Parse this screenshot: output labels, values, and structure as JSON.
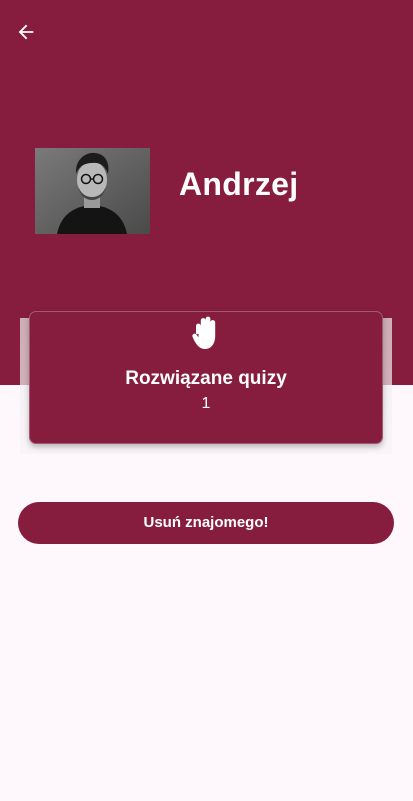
{
  "colors": {
    "primary": "#861d3f",
    "background": "#fef8fd",
    "text_on_primary": "#ffffff"
  },
  "header": {
    "back_icon": "arrow-left-icon"
  },
  "profile": {
    "name": "Andrzej",
    "avatar_icon": "avatar-photo"
  },
  "stats": {
    "icon": "raised-hand-icon",
    "label": "Rozwiązane quizy",
    "value": "1"
  },
  "actions": {
    "remove_friend_label": "Usuń znajomego!"
  }
}
